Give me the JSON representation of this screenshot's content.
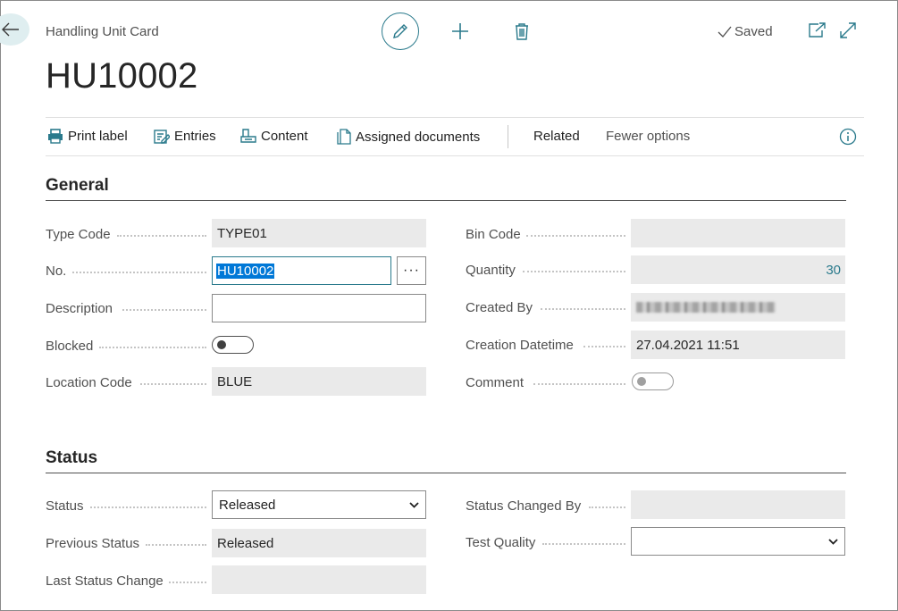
{
  "header": {
    "card_title": "Handling Unit Card",
    "record_no": "HU10002",
    "saved_label": "Saved"
  },
  "actions": {
    "print_label": "Print label",
    "entries": "Entries",
    "content": "Content",
    "assigned_documents": "Assigned documents",
    "related": "Related",
    "fewer_options": "Fewer options"
  },
  "general": {
    "title": "General",
    "type_code": {
      "label": "Type Code",
      "value": "TYPE01"
    },
    "no": {
      "label": "No.",
      "value": "HU10002"
    },
    "description": {
      "label": "Description",
      "value": ""
    },
    "blocked": {
      "label": "Blocked",
      "value": false
    },
    "location_code": {
      "label": "Location Code",
      "value": "BLUE"
    },
    "bin_code": {
      "label": "Bin Code",
      "value": ""
    },
    "quantity": {
      "label": "Quantity",
      "value": "30"
    },
    "created_by": {
      "label": "Created By",
      "value": ""
    },
    "creation_datetime": {
      "label": "Creation Datetime",
      "value": "27.04.2021 11:51"
    },
    "comment": {
      "label": "Comment",
      "value": false
    }
  },
  "status": {
    "title": "Status",
    "status": {
      "label": "Status",
      "value": "Released"
    },
    "previous_status": {
      "label": "Previous Status",
      "value": "Released"
    },
    "last_status_change": {
      "label": "Last Status Change",
      "value": ""
    },
    "status_changed_by": {
      "label": "Status Changed By",
      "value": ""
    },
    "test_quality": {
      "label": "Test Quality",
      "value": ""
    }
  },
  "colors": {
    "accent": "#2a7a8c",
    "selection": "#0078d7",
    "readonly_bg": "#eaeaea"
  }
}
